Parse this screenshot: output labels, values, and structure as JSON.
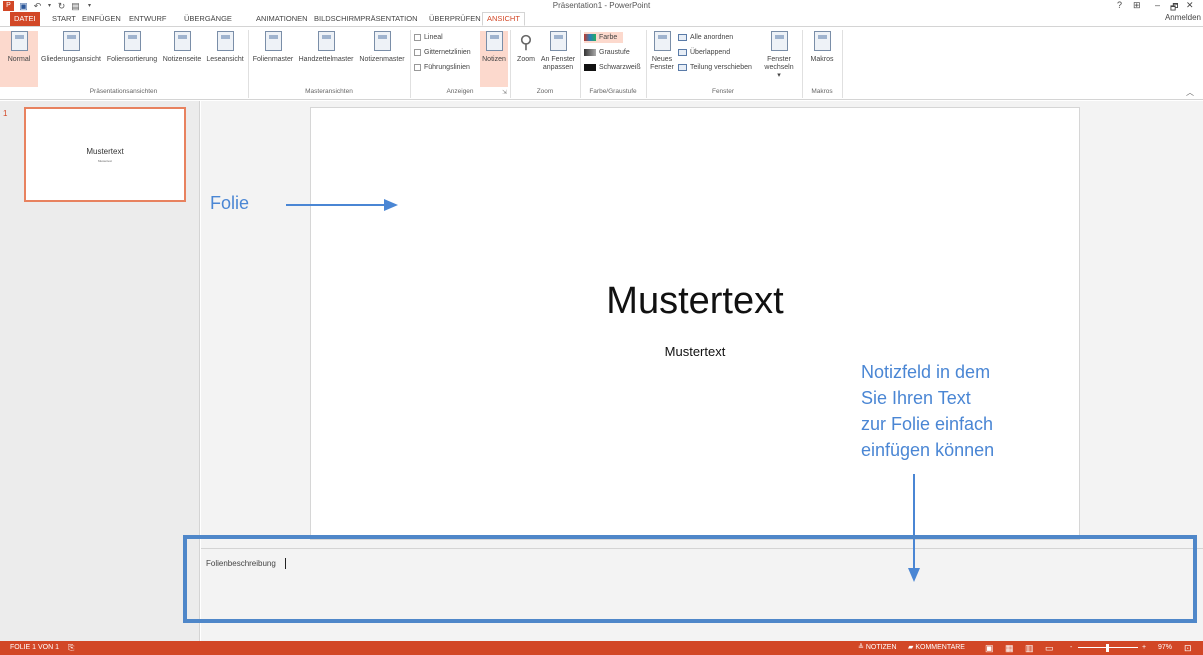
{
  "window": {
    "title": "Präsentation1 - PowerPoint",
    "controls": [
      "?",
      "⊞",
      "–",
      "🗗",
      "✕"
    ],
    "account": "Anmelden"
  },
  "tabs": [
    "DATEI",
    "START",
    "EINFÜGEN",
    "ENTWURF",
    "ÜBERGÄNGE",
    "ANIMATIONEN",
    "BILDSCHIRMPRÄSENTATION",
    "ÜBERPRÜFEN",
    "ANSICHT"
  ],
  "active_tab": "ANSICHT",
  "ribbon": {
    "presentation_views": {
      "label": "Präsentationsansichten",
      "buttons": [
        "Normal",
        "Gliederungsansicht",
        "Foliensortierung",
        "Notizenseite",
        "Leseansicht"
      ]
    },
    "master_views": {
      "label": "Masteransichten",
      "buttons": [
        "Folienmaster",
        "Handzettelmaster",
        "Notizenmaster"
      ]
    },
    "show": {
      "label": "Anzeigen",
      "checkboxes": [
        "Lineal",
        "Gitternetzlinien",
        "Führungslinien"
      ],
      "notes_button": "Notizen"
    },
    "zoom": {
      "label": "Zoom",
      "zoom_button": "Zoom",
      "fit_button_line1": "An Fenster",
      "fit_button_line2": "anpassen"
    },
    "color": {
      "label": "Farbe/Graustufe",
      "options": [
        "Farbe",
        "Graustufe",
        "Schwarzweiß"
      ]
    },
    "window": {
      "label": "Fenster",
      "new_window_line1": "Neues",
      "new_window_line2": "Fenster",
      "options": [
        "Alle anordnen",
        "Überlappend",
        "Teilung verschieben"
      ],
      "switch_line1": "Fenster",
      "switch_line2": "wechseln ▾"
    },
    "macros": {
      "label": "Makros",
      "button": "Makros"
    }
  },
  "thumbnail": {
    "number": "1",
    "title": "Mustertext",
    "subtitle": "Mustertext"
  },
  "slide": {
    "title": "Mustertext",
    "subtitle": "Mustertext"
  },
  "notes": {
    "text": "Folienbeschreibung"
  },
  "annotations": {
    "slide_label": "Folie",
    "notes_label_lines": [
      "Notizfeld in dem",
      "Sie Ihren Text",
      "zur Folie einfach",
      "einfügen können"
    ],
    "color": "#4a86d4"
  },
  "statusbar": {
    "slide_info": "FOLIE 1 VON 1",
    "notes": "NOTIZEN",
    "comments": "KOMMENTARE",
    "zoom": "97%",
    "zoom_minus": "-",
    "zoom_plus": "+"
  },
  "colors": {
    "accent": "#d24726",
    "ribbon_selected": "#fcd9cd"
  }
}
